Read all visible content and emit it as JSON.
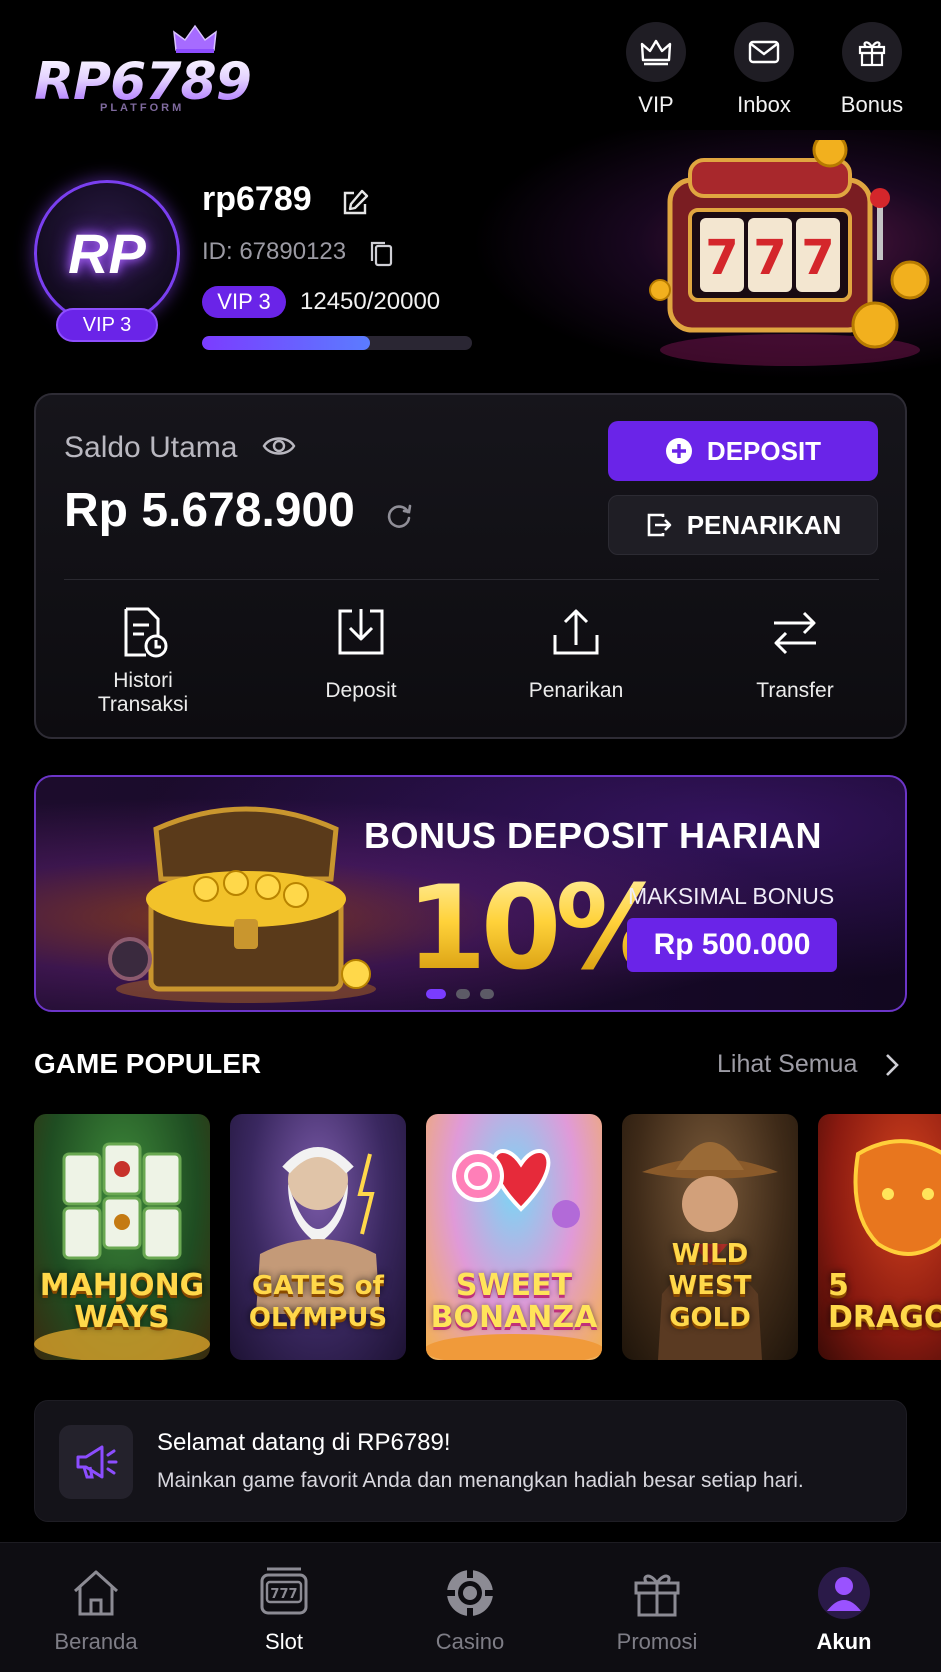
{
  "brand": {
    "logo_text": "RP6789",
    "logo_sub": "PLATFORM"
  },
  "top_actions": [
    {
      "label": "VIP",
      "icon": "crown-icon"
    },
    {
      "label": "Inbox",
      "icon": "mail-icon"
    },
    {
      "label": "Bonus",
      "icon": "gift-icon"
    }
  ],
  "profile": {
    "avatar_text": "RP",
    "avatar_vip": "VIP 3",
    "username": "rp6789",
    "user_id": "ID: 67890123",
    "vip_level": "VIP 3",
    "vip_points": "12450/20000",
    "vip_progress_fraction": 0.6225
  },
  "balance": {
    "label": "Saldo Utama",
    "value": "Rp 5.678.900",
    "deposit_button": "DEPOSIT",
    "withdraw_button": "PENARIKAN",
    "quick_actions": [
      {
        "label": "Histori\nTransaksi",
        "icon": "history-icon"
      },
      {
        "label": "Deposit",
        "icon": "download-icon"
      },
      {
        "label": "Penarikan",
        "icon": "upload-icon"
      },
      {
        "label": "Transfer",
        "icon": "transfer-icon"
      }
    ]
  },
  "promo": {
    "title": "BONUS DEPOSIT HARIAN",
    "percent": "10%",
    "max_label": "MAKSIMAL BONUS",
    "max_amount": "Rp 500.000",
    "slides": 3,
    "active_slide": 1
  },
  "games": {
    "section_title": "GAME POPULER",
    "see_all": "Lihat Semua",
    "items": [
      {
        "name": "MAHJONG\nWAYS"
      },
      {
        "name": "GATES of\nOLYMPUS"
      },
      {
        "name": "SWEET\nBONANZA"
      },
      {
        "name": "WILD WEST\nGOLD"
      },
      {
        "name": "5\nDRAGO"
      }
    ]
  },
  "notice": {
    "title": "Selamat datang di RP6789!",
    "text": "Mainkan game favorit Anda dan menangkan hadiah besar setiap hari."
  },
  "bottom_nav": [
    {
      "label": "Beranda",
      "icon": "home-icon"
    },
    {
      "label": "Slot",
      "icon": "slot-machine-icon"
    },
    {
      "label": "Casino",
      "icon": "chip-icon"
    },
    {
      "label": "Promosi",
      "icon": "gift-icon"
    },
    {
      "label": "Akun",
      "icon": "user-icon",
      "active": true
    }
  ],
  "colors": {
    "accent": "#6a24e8",
    "background": "#000000",
    "card": "#16151b",
    "gold": "#ffd23a"
  }
}
